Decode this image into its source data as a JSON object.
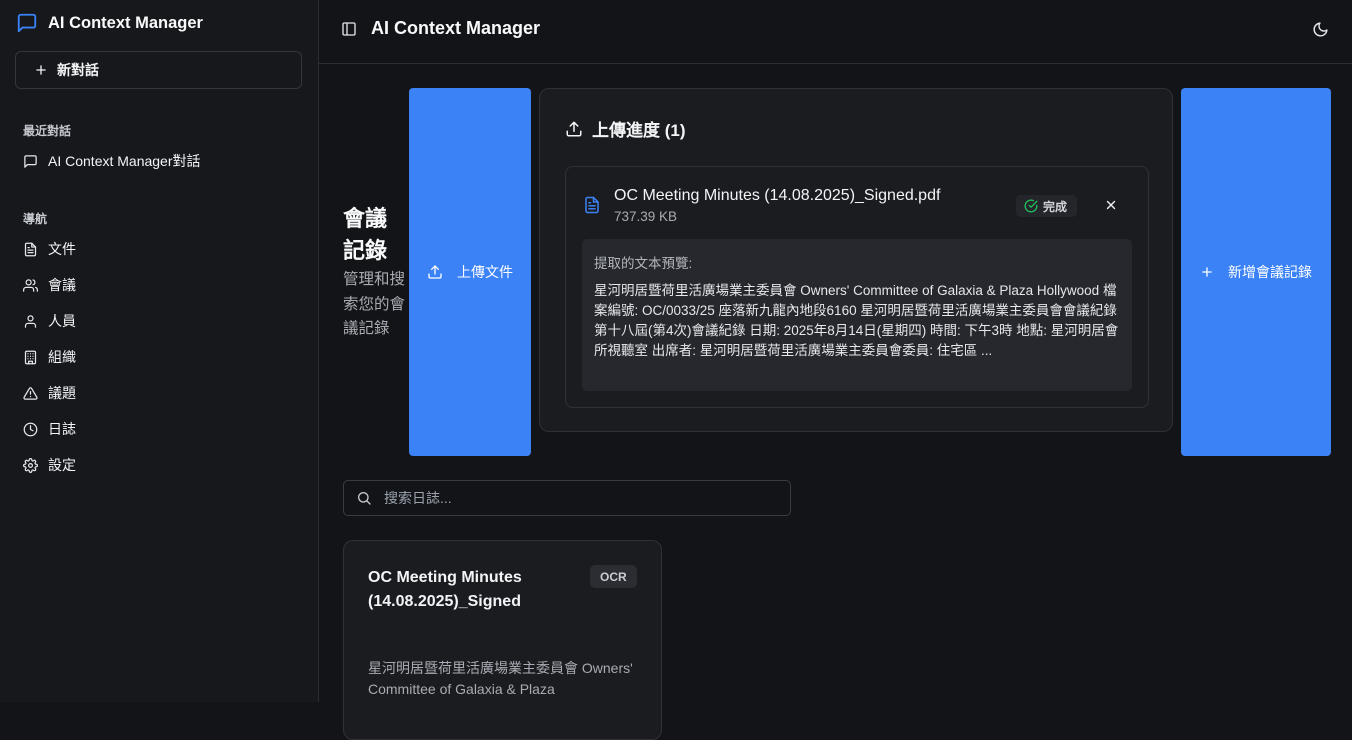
{
  "app": {
    "name": "AI Context Manager",
    "header_title": "AI Context Manager"
  },
  "sidebar": {
    "new_chat_label": "新對話",
    "recent_label": "最近對話",
    "recent_items": [
      {
        "label": "AI Context Manager對話",
        "icon": "message-icon"
      }
    ],
    "nav_label": "導航",
    "nav_items": [
      {
        "label": "文件",
        "icon": "file-text-icon"
      },
      {
        "label": "會議",
        "icon": "users-icon"
      },
      {
        "label": "人員",
        "icon": "user-icon"
      },
      {
        "label": "組織",
        "icon": "building-icon"
      },
      {
        "label": "議題",
        "icon": "alert-triangle-icon"
      },
      {
        "label": "日誌",
        "icon": "clock-icon"
      },
      {
        "label": "設定",
        "icon": "settings-icon"
      }
    ]
  },
  "main": {
    "page_title": "會議記錄",
    "page_description": "管理和搜索您的會議記錄",
    "upload_button_label": "上傳文件",
    "add_record_button_label": "新增會議記錄",
    "upload_progress": {
      "heading": "上傳進度 (1)",
      "file": {
        "name": "OC Meeting Minutes (14.08.2025)_Signed.pdf",
        "size": "737.39 KB",
        "status": "完成",
        "preview_label": "提取的文本預覽:",
        "preview_text": "星河明居暨荷里活廣場業主委員會 Owners' Committee of Galaxia & Plaza Hollywood 檔案編號: OC/0033/25 座落新九龍內地段6160 星河明居暨荷里活廣場業主委員會會議紀錄 第十八屆(第4次)會議紀錄 日期: 2025年8月14日(星期四) 時間: 下午3時 地點: 星河明居會所視聽室 出席者: 星河明居暨荷里活廣場業主委員會委員: 住宅區 ..."
      }
    },
    "search": {
      "placeholder": "搜索日誌...",
      "value": ""
    },
    "log_cards": [
      {
        "title": "OC Meeting Minutes (14.08.2025)_Signed",
        "badge": "OCR",
        "excerpt": "星河明居暨荷里活廣場業主委員會 Owners' Committee of Galaxia & Plaza"
      }
    ]
  },
  "colors": {
    "background": "#131417",
    "sidebar": "#17181c",
    "accent": "#3b82f6",
    "success": "#22c55e"
  }
}
